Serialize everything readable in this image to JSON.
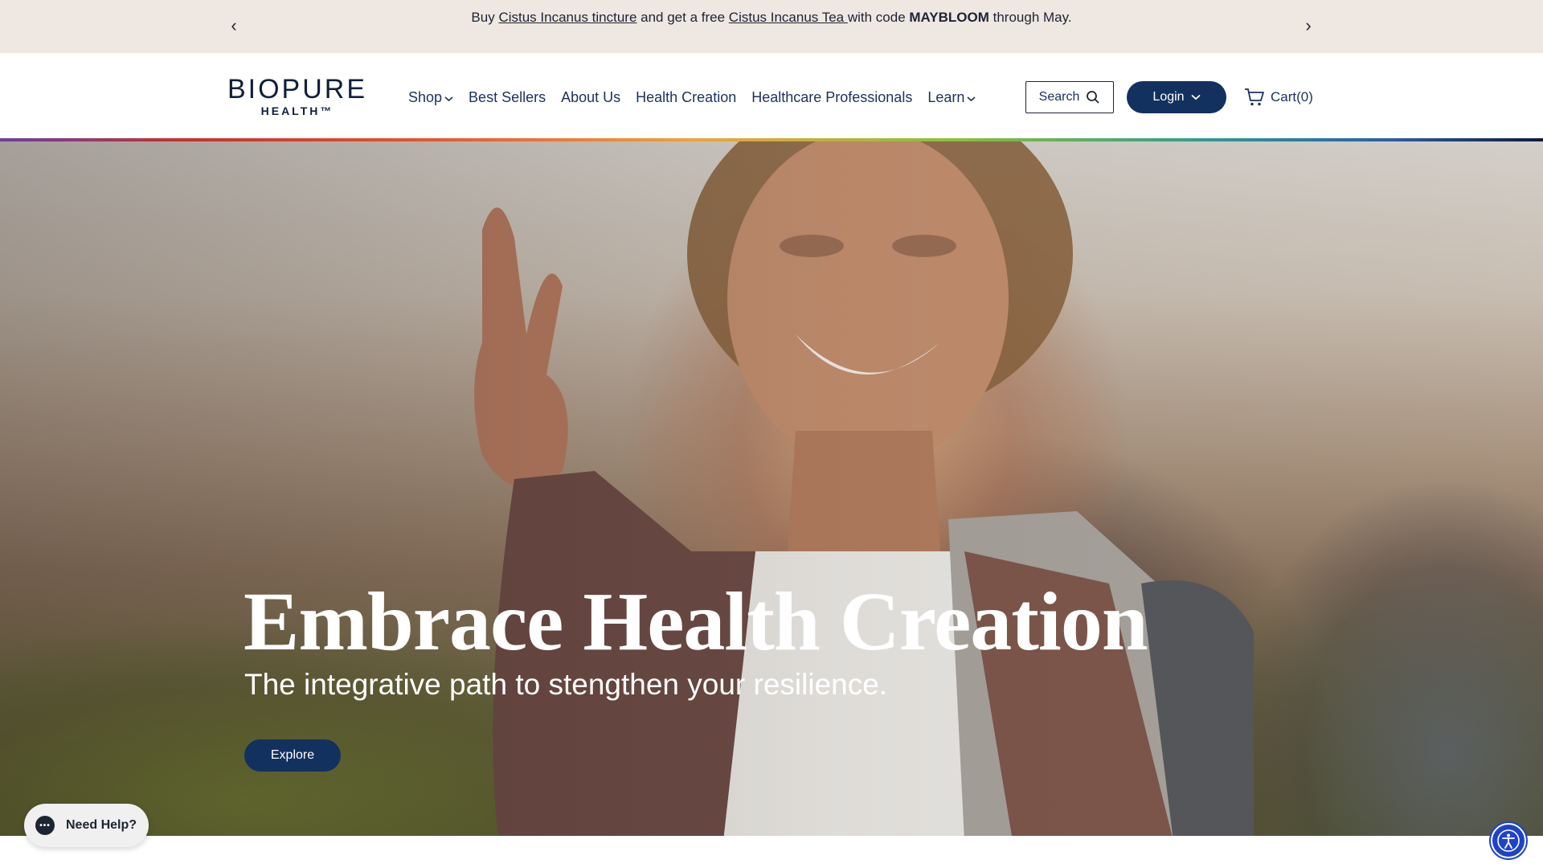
{
  "announcement": {
    "prev_arrow": "‹",
    "next_arrow": "›",
    "text_before": "Buy ",
    "link1": "Cistus Incanus tincture",
    "text_mid": " and get a free ",
    "link2": "Cistus Incanus Tea ",
    "text_code_intro": "with code ",
    "code": "MAYBLOOM",
    "text_after": " through May."
  },
  "header": {
    "logo_word": "BIOPURE",
    "logo_sub": "HEALTH™",
    "nav": [
      {
        "label": "Shop",
        "has_dropdown": true
      },
      {
        "label": "Best Sellers",
        "has_dropdown": false
      },
      {
        "label": "About Us",
        "has_dropdown": false
      },
      {
        "label": "Health Creation",
        "has_dropdown": false
      },
      {
        "label": "Healthcare Professionals",
        "has_dropdown": false
      },
      {
        "label": "Learn",
        "has_dropdown": true
      }
    ],
    "search_label": "Search",
    "login_label": "Login",
    "cart_label": "Cart(0)"
  },
  "hero": {
    "title": "Embrace Health Creation",
    "subtitle": "The integrative path to stengthen your resilience.",
    "cta_label": "Explore"
  },
  "widgets": {
    "help_label": "Need Help?",
    "help_icon": "chat-bubble-icon",
    "accessibility_icon": "accessibility-icon"
  },
  "colors": {
    "announcement_bg": "#efe7e1",
    "brand_navy": "#13315e",
    "accessibility_blue": "#1f43c8"
  }
}
